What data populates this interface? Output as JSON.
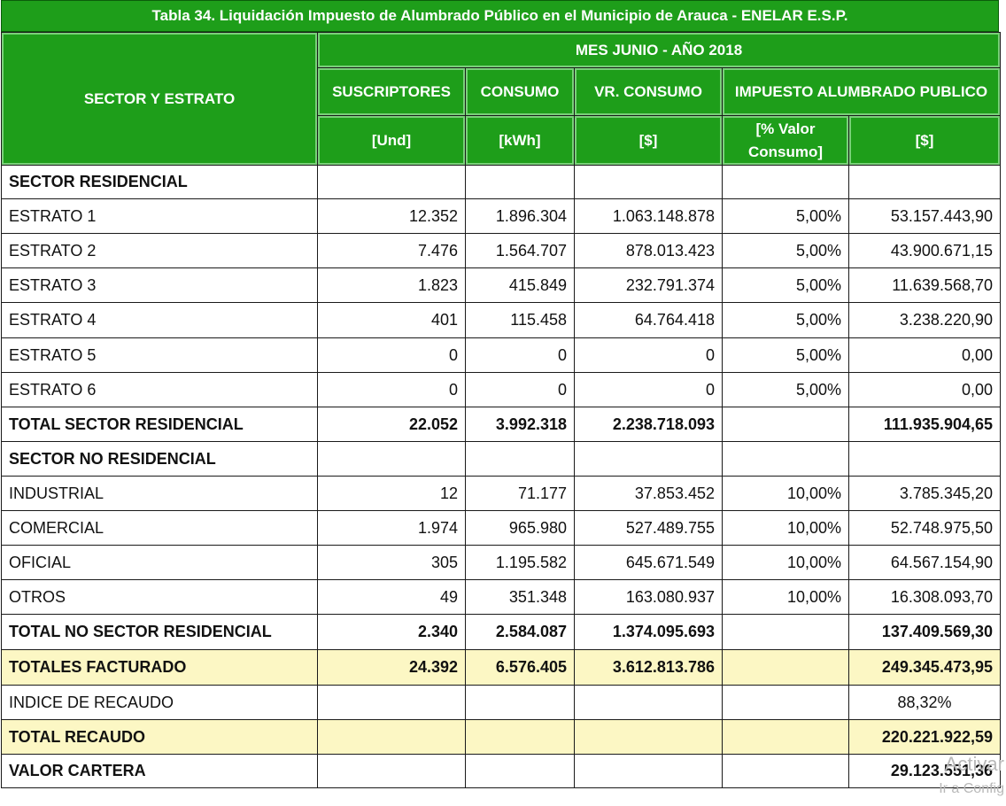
{
  "title": "Tabla  34.  Liquidación Impuesto de Alumbrado Público en el Municipio de Arauca - ENELAR E.S.P.",
  "header": {
    "sector_estrato": "SECTOR Y ESTRATO",
    "period": "MES JUNIO - AÑO 2018",
    "suscriptores": "SUSCRIPTORES",
    "consumo": "CONSUMO",
    "vr_consumo": "VR. CONSUMO",
    "impuesto": "IMPUESTO ALUMBRADO PUBLICO",
    "unit_und": "[Und]",
    "unit_kwh": "[kWh]",
    "unit_cop_1": "[$]",
    "unit_pct": "[% Valor Consumo]",
    "unit_cop_2": "[$]"
  },
  "rows": [
    {
      "label": "SECTOR RESIDENCIAL",
      "suscriptores": "",
      "consumo": "",
      "vr_consumo": "",
      "pct": "",
      "impuesto": ""
    },
    {
      "label": "ESTRATO 1",
      "suscriptores": "12.352",
      "consumo": "1.896.304",
      "vr_consumo": "1.063.148.878",
      "pct": "5,00%",
      "impuesto": "53.157.443,90"
    },
    {
      "label": "ESTRATO 2",
      "suscriptores": "7.476",
      "consumo": "1.564.707",
      "vr_consumo": "878.013.423",
      "pct": "5,00%",
      "impuesto": "43.900.671,15"
    },
    {
      "label": "ESTRATO 3",
      "suscriptores": "1.823",
      "consumo": "415.849",
      "vr_consumo": "232.791.374",
      "pct": "5,00%",
      "impuesto": "11.639.568,70"
    },
    {
      "label": "ESTRATO 4",
      "suscriptores": "401",
      "consumo": "115.458",
      "vr_consumo": "64.764.418",
      "pct": "5,00%",
      "impuesto": "3.238.220,90"
    },
    {
      "label": "ESTRATO 5",
      "suscriptores": "0",
      "consumo": "0",
      "vr_consumo": "0",
      "pct": "5,00%",
      "impuesto": "0,00"
    },
    {
      "label": "ESTRATO 6",
      "suscriptores": "0",
      "consumo": "0",
      "vr_consumo": "0",
      "pct": "5,00%",
      "impuesto": "0,00"
    },
    {
      "label": "TOTAL SECTOR RESIDENCIAL",
      "suscriptores": "22.052",
      "consumo": "3.992.318",
      "vr_consumo": "2.238.718.093",
      "pct": "",
      "impuesto": "111.935.904,65"
    },
    {
      "label": "SECTOR NO RESIDENCIAL",
      "suscriptores": "",
      "consumo": "",
      "vr_consumo": "",
      "pct": "",
      "impuesto": ""
    },
    {
      "label": "INDUSTRIAL",
      "suscriptores": "12",
      "consumo": "71.177",
      "vr_consumo": "37.853.452",
      "pct": "10,00%",
      "impuesto": "3.785.345,20"
    },
    {
      "label": "COMERCIAL",
      "suscriptores": "1.974",
      "consumo": "965.980",
      "vr_consumo": "527.489.755",
      "pct": "10,00%",
      "impuesto": "52.748.975,50"
    },
    {
      "label": "OFICIAL",
      "suscriptores": "305",
      "consumo": "1.195.582",
      "vr_consumo": "645.671.549",
      "pct": "10,00%",
      "impuesto": "64.567.154,90"
    },
    {
      "label": "OTROS",
      "suscriptores": "49",
      "consumo": "351.348",
      "vr_consumo": "163.080.937",
      "pct": "10,00%",
      "impuesto": "16.308.093,70"
    },
    {
      "label": "TOTAL NO SECTOR RESIDENCIAL",
      "suscriptores": "2.340",
      "consumo": "2.584.087",
      "vr_consumo": "1.374.095.693",
      "pct": "",
      "impuesto": "137.409.569,30"
    },
    {
      "label": "TOTALES FACTURADO",
      "suscriptores": "24.392",
      "consumo": "6.576.405",
      "vr_consumo": "3.612.813.786",
      "pct": "",
      "impuesto": "249.345.473,95"
    },
    {
      "label": "INDICE DE RECAUDO",
      "suscriptores": "",
      "consumo": "",
      "vr_consumo": "",
      "pct": "",
      "impuesto": "88,32%"
    },
    {
      "label": "TOTAL RECAUDO",
      "suscriptores": "",
      "consumo": "",
      "vr_consumo": "",
      "pct": "",
      "impuesto": "220.221.922,59"
    },
    {
      "label": "VALOR CARTERA",
      "suscriptores": "",
      "consumo": "",
      "vr_consumo": "",
      "pct": "",
      "impuesto": "29.123.551,36"
    }
  ],
  "watermark": {
    "line1": "Activar",
    "line2": "Ir a Config"
  },
  "colors": {
    "header_green": "#1e9e1a",
    "highlight_yellow": "#fcf7c4"
  }
}
